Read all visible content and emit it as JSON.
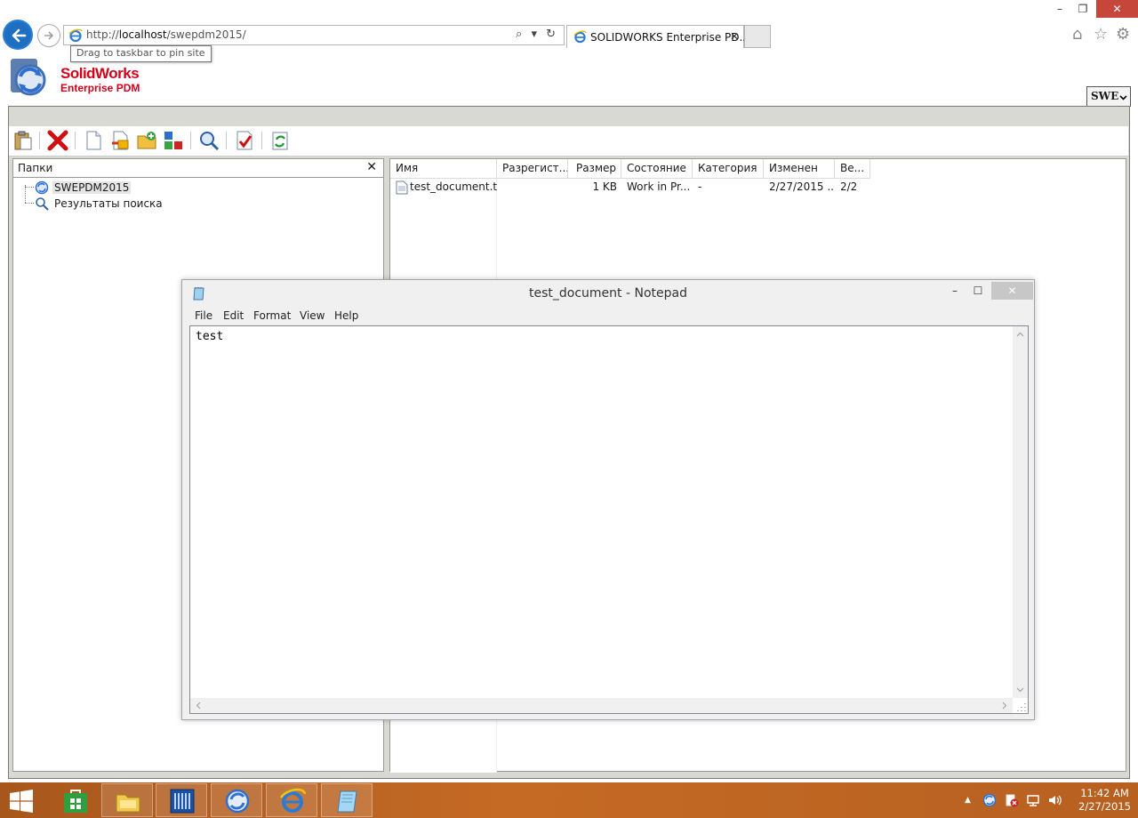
{
  "browser": {
    "url_prefix": "http://",
    "url_host": "localhost",
    "url_path": "/swepdm2015/",
    "address_tools": "⌕ ▾ ↻",
    "tab_title": "SOLIDWORKS Enterprise PD...",
    "tab_close": "✕",
    "tooltip": "Drag to taskbar to pin site",
    "window_controls": {
      "minimize": "–",
      "maximize": "❐",
      "close": "✕"
    },
    "right_tools": {
      "home": "⌂",
      "favorites": "☆",
      "settings": "⚙"
    }
  },
  "pdm": {
    "brand_line1": "SolidWorks",
    "brand_line2": "Enterprise PDM",
    "vault_selector": "SWE",
    "toolbar_icons": [
      "clipboard-icon",
      "delete-icon",
      "new-file-icon",
      "add-file-icon",
      "add-folder-icon",
      "structure-icon",
      "search-icon",
      "checkin-icon",
      "refresh-icon"
    ],
    "folders_panel": {
      "title": "Папки",
      "close": "✕",
      "items": [
        {
          "label": "SWEPDM2015",
          "icon": "vault-icon",
          "selected": true
        },
        {
          "label": "Результаты поиска",
          "icon": "search-results-icon",
          "selected": false
        }
      ]
    },
    "file_list": {
      "columns": [
        "Имя",
        "Разрегист...",
        "Размер",
        "Состояние",
        "Категория",
        "Изменен",
        "Ве..."
      ],
      "rows": [
        {
          "name": "test_document.txt",
          "checked_out": "",
          "size": "1 KB",
          "state": "Work in Pr...",
          "category": "-",
          "modified": "2/27/2015 ...",
          "version": "2/2"
        }
      ]
    }
  },
  "notepad": {
    "title": "test_document - Notepad",
    "controls": {
      "minimize": "–",
      "maximize": "☐",
      "close": "✕"
    },
    "menu": [
      "File",
      "Edit",
      "Format",
      "View",
      "Help"
    ],
    "content": "test"
  },
  "taskbar": {
    "apps": [
      "store-icon",
      "file-explorer-icon",
      "server-manager-icon",
      "pdm-icon",
      "internet-explorer-icon",
      "notepad-icon"
    ],
    "tray_arrow": "▲",
    "time": "11:42 AM",
    "date": "2/27/2015"
  },
  "colors": {
    "brand_red": "#d4001a",
    "ie_blue": "#1e6fc2",
    "close_red": "#c7463b",
    "taskbar": "#b9621f"
  }
}
